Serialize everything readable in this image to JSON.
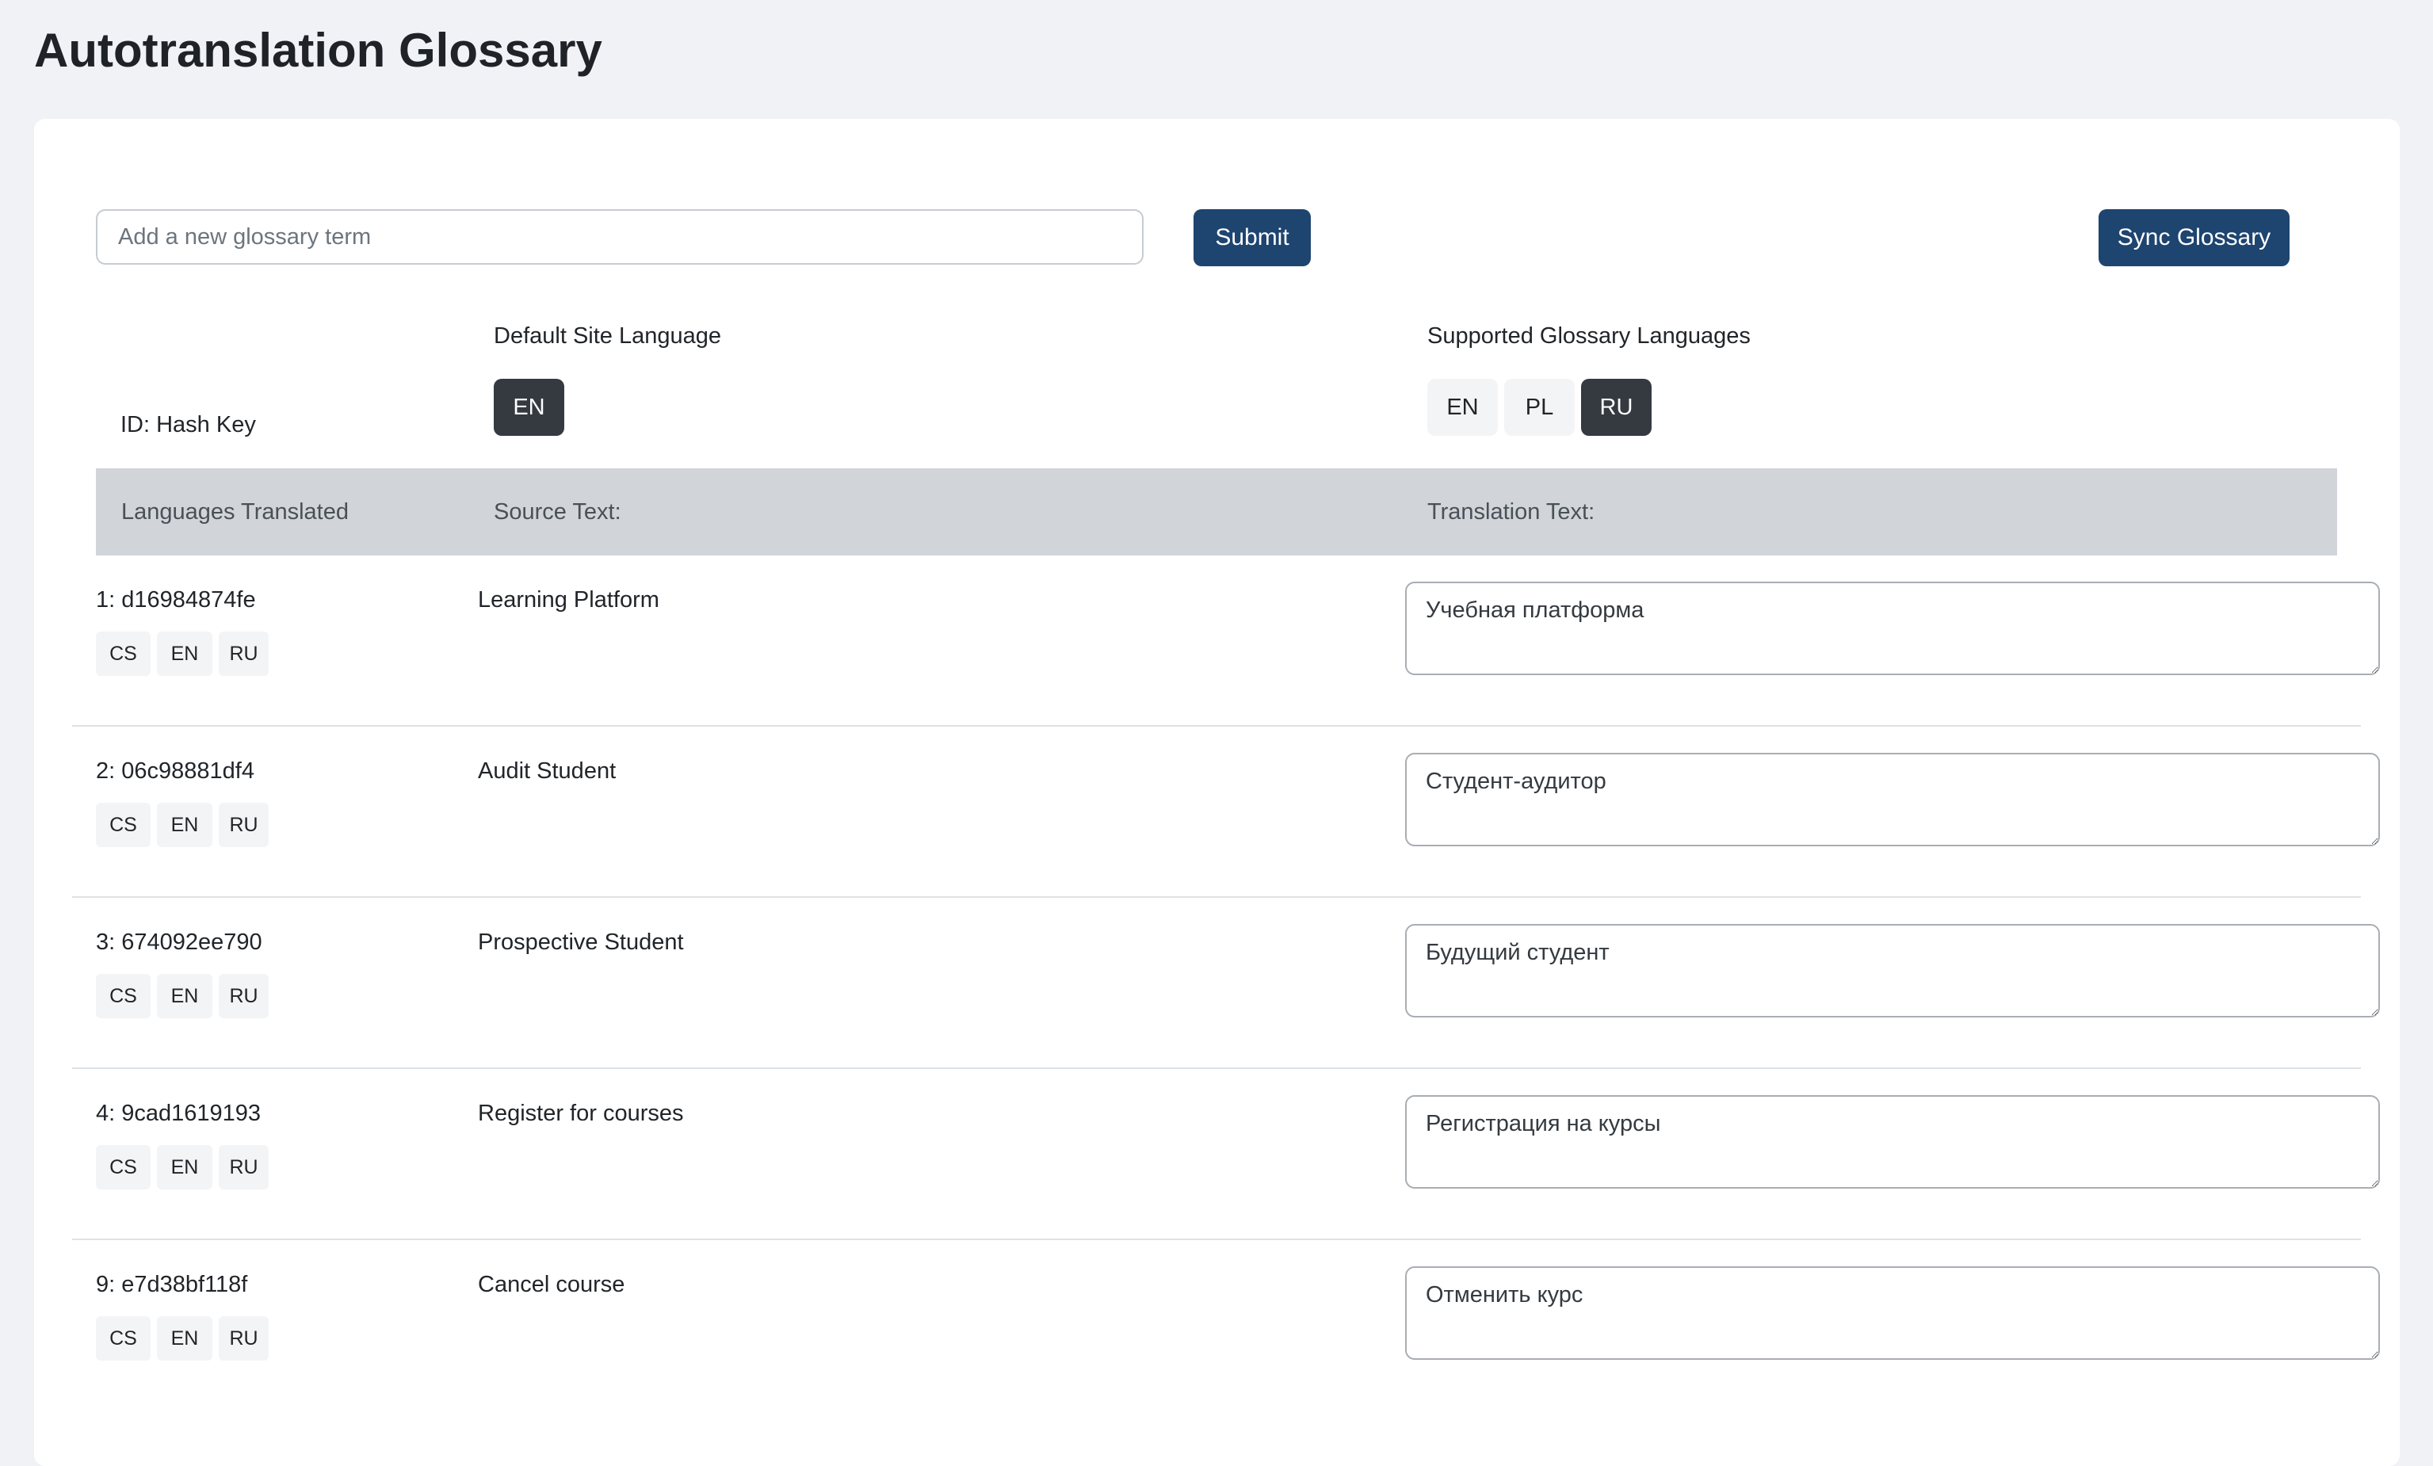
{
  "page": {
    "title": "Autotranslation Glossary"
  },
  "form": {
    "placeholder": "Add a new glossary term",
    "value": "",
    "submit_label": "Submit",
    "sync_label": "Sync Glossary"
  },
  "default_language": {
    "heading": "Default Site Language",
    "options": [
      {
        "label": "EN",
        "selected": true
      }
    ]
  },
  "supported_languages": {
    "heading": "Supported Glossary Languages",
    "options": [
      {
        "label": "EN",
        "selected": false
      },
      {
        "label": "PL",
        "selected": false
      },
      {
        "label": "RU",
        "selected": true
      }
    ]
  },
  "id_label": "ID: Hash Key",
  "table": {
    "headers": {
      "languages": "Languages Translated",
      "source": "Source Text:",
      "translation": "Translation Text:"
    },
    "rows": [
      {
        "id": "1: d16984874fe",
        "langs": [
          "CS",
          "EN",
          "RU"
        ],
        "source": "Learning Platform",
        "translation": "Учебная платформа"
      },
      {
        "id": "2: 06c98881df4",
        "langs": [
          "CS",
          "EN",
          "RU"
        ],
        "source": "Audit Student",
        "translation": "Студент-аудитор"
      },
      {
        "id": "3: 674092ee790",
        "langs": [
          "CS",
          "EN",
          "RU"
        ],
        "source": "Prospective Student",
        "translation": "Будущий студент"
      },
      {
        "id": "4: 9cad1619193",
        "langs": [
          "CS",
          "EN",
          "RU"
        ],
        "source": "Register for courses",
        "translation": "Регистрация на курсы"
      },
      {
        "id": "9: e7d38bf118f",
        "langs": [
          "CS",
          "EN",
          "RU"
        ],
        "source": "Cancel course",
        "translation": "Отменить курс"
      }
    ]
  },
  "colors": {
    "primary_button": "#1e4470",
    "active_language": "#343a40",
    "header_background": "#d1d5d9",
    "page_background": "#f1f2f6"
  }
}
